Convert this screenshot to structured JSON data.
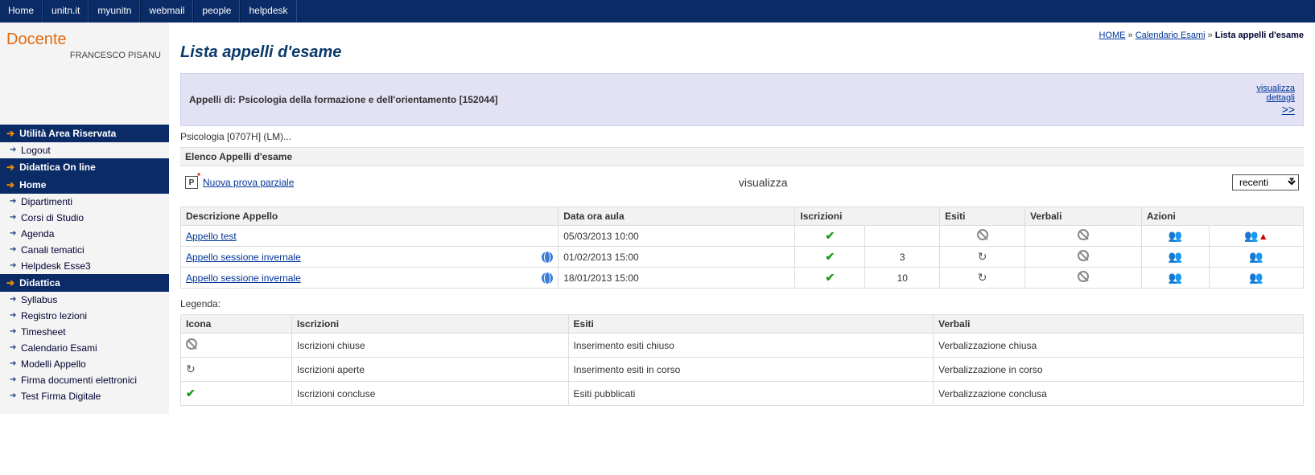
{
  "topnav": [
    "Home",
    "unitn.it",
    "myunitn",
    "webmail",
    "people",
    "helpdesk"
  ],
  "role_title": "Docente",
  "user_name": "FRANCESCO PISANU",
  "breadcrumb": {
    "home": "HOME",
    "mid": "Calendario Esami",
    "current": "Lista appelli d'esame"
  },
  "page_title": "Lista appelli d'esame",
  "infobox": {
    "label": "Appelli di: Psicologia della formazione e dell'orientamento [152044]",
    "link1": "visualizza",
    "link2": "dettagli",
    "expand": ">>"
  },
  "subline": "Psicologia [0707H] (LM)...",
  "elenco_label": "Elenco Appelli d'esame",
  "new_link": "Nuova prova parziale",
  "visualizza_label": "visualizza",
  "filter_value": "recenti",
  "menu": {
    "head1": "Utilità Area Riservata",
    "items1": [
      "Logout"
    ],
    "head2": "Didattica On line",
    "head3": "Home",
    "items3": [
      "Dipartimenti",
      "Corsi di Studio",
      "Agenda",
      "Canali tematici",
      "Helpdesk Esse3"
    ],
    "head4": "Didattica",
    "items4": [
      "Syllabus",
      "Registro lezioni",
      "Timesheet",
      "Calendario Esami",
      "Modelli Appello",
      "Firma documenti elettronici",
      "Test Firma Digitale"
    ]
  },
  "table": {
    "headers": [
      "Descrizione Appello",
      "Data ora aula",
      "Iscrizioni",
      "Esiti",
      "Verbali",
      "Azioni"
    ],
    "rows": [
      {
        "desc": "Appello test",
        "globe": false,
        "date": "05/03/2013 10:00",
        "iscr_icon": "check",
        "iscr_count": "",
        "esiti": "forbid",
        "verbali": "forbid",
        "a1": "action",
        "a2": "warn"
      },
      {
        "desc": "Appello sessione invernale",
        "globe": true,
        "date": "01/02/2013 15:00",
        "iscr_icon": "check",
        "iscr_count": "3",
        "esiti": "reload",
        "verbali": "forbid",
        "a1": "action",
        "a2": "action"
      },
      {
        "desc": "Appello sessione invernale",
        "globe": true,
        "date": "18/01/2013 15:00",
        "iscr_icon": "check",
        "iscr_count": "10",
        "esiti": "reload",
        "verbali": "forbid",
        "a1": "action",
        "a2": "action"
      }
    ]
  },
  "legend_title": "Legenda:",
  "legend": {
    "headers": [
      "Icona",
      "Iscrizioni",
      "Esiti",
      "Verbali"
    ],
    "rows": [
      {
        "icon": "forbid",
        "iscr": "Iscrizioni chiuse",
        "esiti": "Inserimento esiti chiuso",
        "verb": "Verbalizzazione chiusa"
      },
      {
        "icon": "reload",
        "iscr": "Iscrizioni aperte",
        "esiti": "Inserimento esiti in corso",
        "verb": "Verbalizzazione in corso"
      },
      {
        "icon": "check",
        "iscr": "Iscrizioni concluse",
        "esiti": "Esiti pubblicati",
        "verb": "Verbalizzazione conclusa"
      }
    ]
  }
}
